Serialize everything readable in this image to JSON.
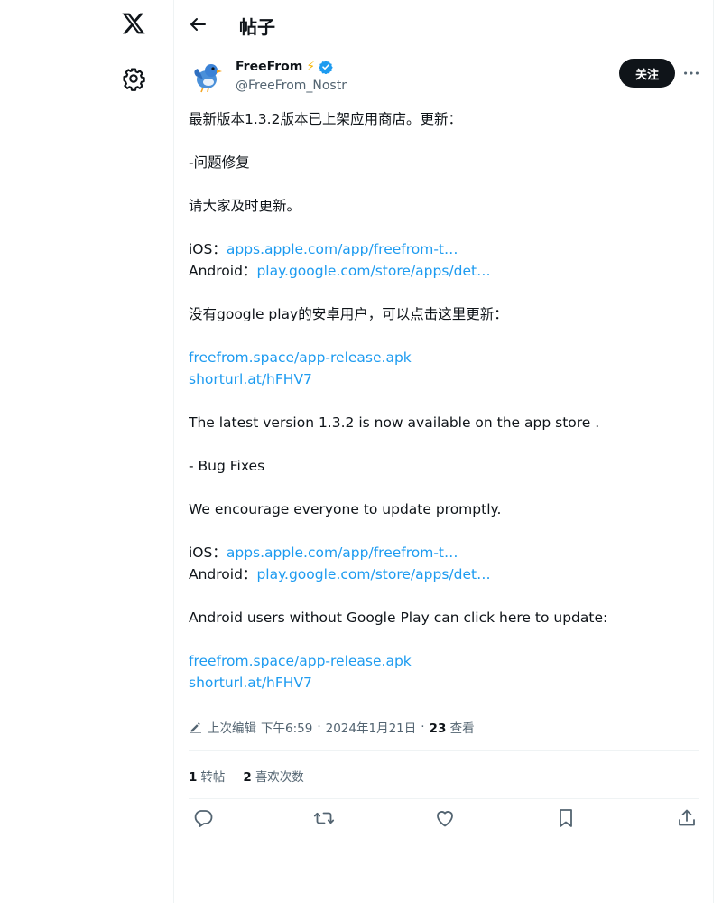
{
  "nav": {
    "logo_icon": "x-logo-icon",
    "settings_icon": "gear-icon"
  },
  "header": {
    "title": "帖子"
  },
  "author": {
    "name": "FreeFrom",
    "emoji": "⚡",
    "handle": "@FreeFrom_Nostr",
    "verified": true
  },
  "follow_label": "关注",
  "post": {
    "cn_intro": "最新版本1.3.2版本已上架应用商店。更新：",
    "cn_fix": "-问题修复",
    "cn_update": "请大家及时更新。",
    "ios_label": "iOS：",
    "ios_link": "apps.apple.com/app/freefrom-t…",
    "android_label": "Android：",
    "android_link": "play.google.com/store/apps/det…",
    "cn_no_gp": "没有google play的安卓用户，可以点击这里更新：",
    "apk_link": "freefrom.space/app-release.apk",
    "short_link": "shorturl.at/hFHV7",
    "en_intro": "The latest version 1.3.2 is now available on the app store .",
    "en_fix": "- Bug Fixes",
    "en_update": "We encourage everyone to update promptly.",
    "en_no_gp": "Android users without Google Play can click here to update:"
  },
  "meta": {
    "edited": "上次编辑",
    "time": "下午6:59",
    "date": "2024年1月21日",
    "dot": "·",
    "views_count": "23",
    "views_label": "查看"
  },
  "stats": {
    "reposts_count": "1",
    "reposts_label": "转帖",
    "likes_count": "2",
    "likes_label": "喜欢次数"
  },
  "actions": [
    "reply-icon",
    "repost-icon",
    "like-icon",
    "bookmark-icon",
    "share-icon"
  ],
  "colors": {
    "link": "#1d9bf0",
    "text": "#0f1419",
    "muted": "#536471",
    "verified": "#1d9bf0"
  }
}
